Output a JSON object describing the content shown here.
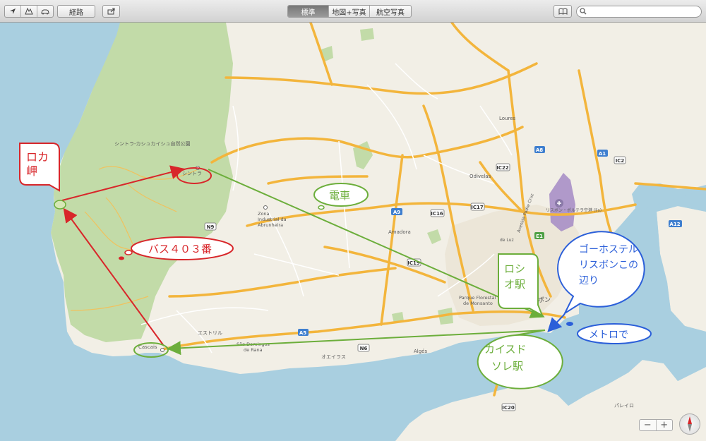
{
  "toolbar": {
    "directions_label": "経路",
    "view_modes": [
      {
        "label": "標準",
        "active": true
      },
      {
        "label": "地図+写真",
        "active": false
      },
      {
        "label": "航空写真",
        "active": false
      }
    ],
    "search_placeholder": ""
  },
  "map": {
    "places": {
      "sintra_park": "シントラ-カシュカイシュ自然公園",
      "sintra": "シントラ",
      "zona_industrial": "Zona\nIndustrial da\nAbrunheira",
      "amadora": "Amadora",
      "odivelas": "Odivelas",
      "loures": "Loures",
      "airport": "リスボン・ポルテラ空港 (lis)",
      "monsanto": "Parque Florestal\nde Monsanto",
      "lisbon_partial": "ボン",
      "estoril": "エストリル",
      "cascais": "Cascais",
      "sao_domingos": "São Domingos\nde Rana",
      "oeiras": "オエイラス",
      "alges": "Algés",
      "pareie": "パレイロ",
      "avenida": "Avenida Padre Cruz",
      "luz": "de Luz"
    },
    "road_shields": {
      "n9": "N9",
      "a9": "A9",
      "ic16": "IC16",
      "ic17": "IC17",
      "ic22": "IC22",
      "a8": "A8",
      "a1": "A1",
      "ic2": "IC2",
      "a12": "A12",
      "e1": "E1",
      "ic19": "IC19",
      "a5": "A5",
      "n6": "N6",
      "ic20": "IC20"
    },
    "zoom_out": "−",
    "zoom_in": "+"
  },
  "annotations": {
    "roca": "ロカ\n岬",
    "bus": "バス４０３番",
    "train": "電車",
    "rossio": "ロシ\nオ駅",
    "hostel": "ゴーホステル\nリスボンこの\n辺り",
    "metro": "メトロで",
    "caisdosodre": "カイスド\nソレ駅"
  },
  "colors": {
    "land": "#f2efe6",
    "water": "#a9cfe0",
    "park": "#c2dba8",
    "highway": "#f3b53c",
    "road": "#ffffff",
    "annotation_red": "#d8262a",
    "annotation_green": "#6cae3b",
    "annotation_blue": "#2b5fd9",
    "airport": "#a88fc6"
  },
  "icons": [
    "location-arrow-icon",
    "3d-view-icon",
    "car-icon",
    "share-icon",
    "bookmarks-icon",
    "search-icon",
    "compass-icon",
    "airport-icon"
  ]
}
